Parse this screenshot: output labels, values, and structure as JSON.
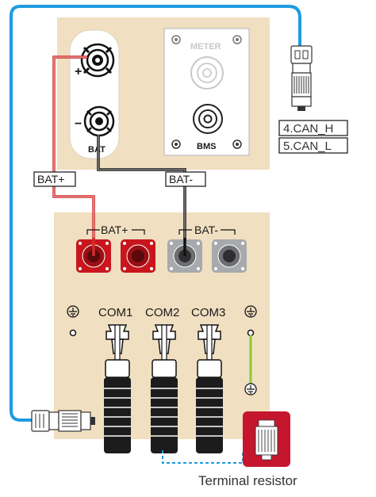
{
  "colors": {
    "panel": "#f1dfc1",
    "wire_red": "#d12b2b",
    "wire_black": "#111111",
    "comm_cable": "#1f9be0",
    "ground_wire": "#8cc63f",
    "terminal_red": "#c8161d",
    "terminal_grey": "#a7a9ac",
    "resistor_red": "#c5162e"
  },
  "battery": {
    "plus_sign": "+",
    "minus_sign": "−",
    "bat_label": "BAT",
    "meter_label": "METER",
    "bms_label": "BMS"
  },
  "connector": {
    "can_h": "4.CAN_H",
    "can_l": "5.CAN_L"
  },
  "wires": {
    "bat_plus": "BAT+",
    "bat_minus": "BAT-"
  },
  "inverter": {
    "bat_plus_group": "BAT+",
    "bat_minus_group": "BAT-",
    "com1": "COM1",
    "com2": "COM2",
    "com3": "COM3"
  },
  "icons": [
    "ground-icon",
    "rj45-connector-icon",
    "terminal-resistor-icon"
  ],
  "terminal_resistor": "Terminal resistor"
}
